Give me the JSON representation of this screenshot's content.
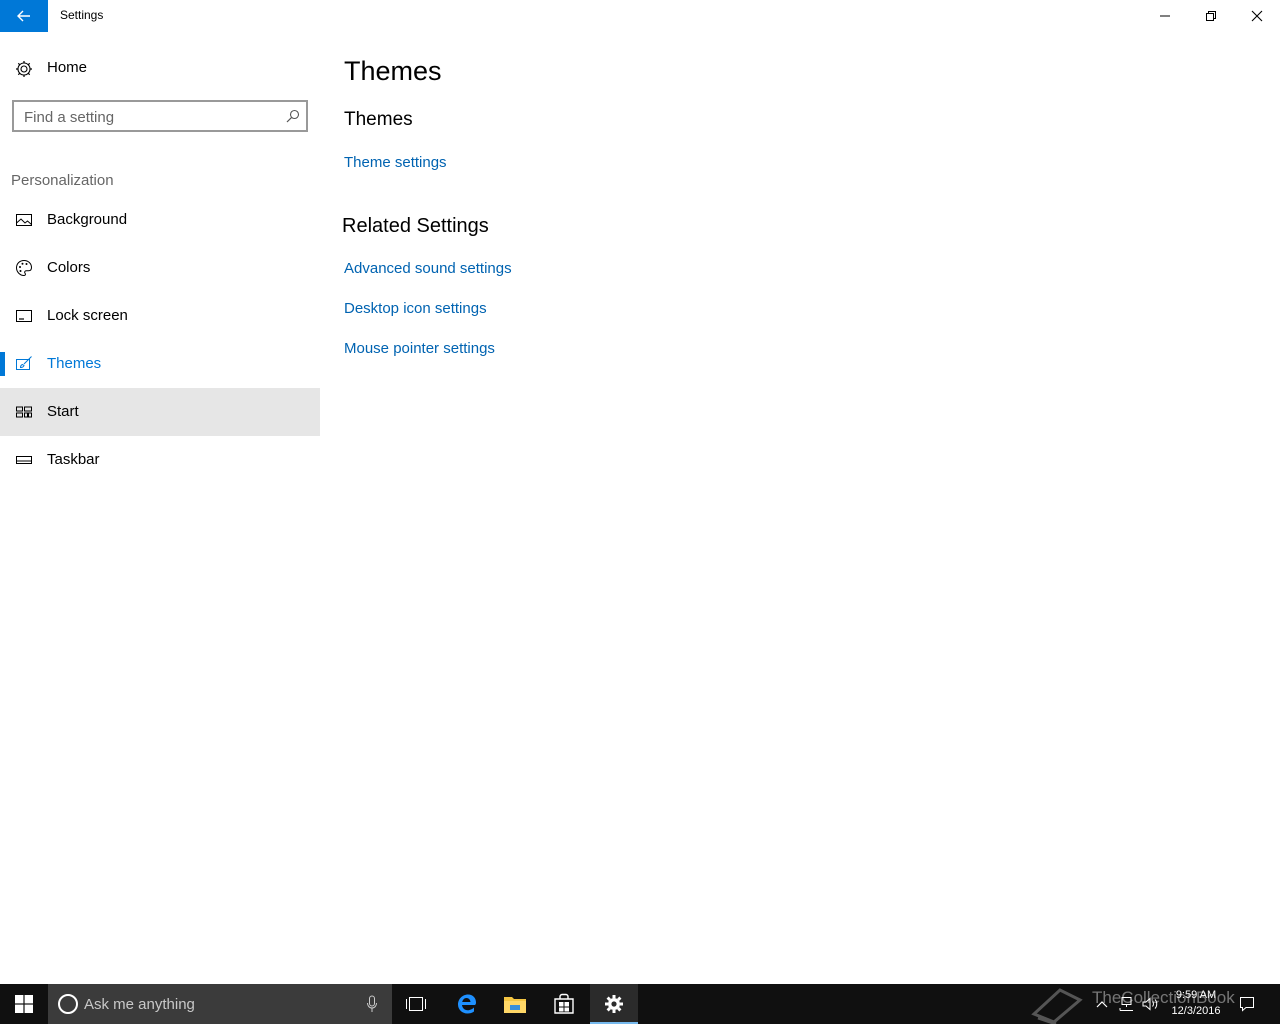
{
  "window": {
    "title": "Settings"
  },
  "sidebar": {
    "home_label": "Home",
    "search_placeholder": "Find a setting",
    "section_label": "Personalization",
    "items": [
      {
        "label": "Background",
        "icon": "picture-icon"
      },
      {
        "label": "Colors",
        "icon": "palette-icon"
      },
      {
        "label": "Lock screen",
        "icon": "lock-screen-icon"
      },
      {
        "label": "Themes",
        "icon": "brush-icon",
        "selected": true
      },
      {
        "label": "Start",
        "icon": "start-tiles-icon",
        "hovered": true
      },
      {
        "label": "Taskbar",
        "icon": "taskbar-icon"
      }
    ]
  },
  "main": {
    "page_title": "Themes",
    "themes_heading": "Themes",
    "theme_settings_link": "Theme settings",
    "related_heading": "Related Settings",
    "related_links": [
      "Advanced sound settings",
      "Desktop icon settings",
      "Mouse pointer settings"
    ]
  },
  "taskbar": {
    "search_placeholder": "Ask me anything",
    "time": "9:59 AM",
    "date": "12/3/2016",
    "watermark": "TheCollectionBook"
  },
  "colors": {
    "accent": "#0078d7",
    "link": "#0063b1",
    "taskbar": "#101010",
    "hover": "#e6e6e6"
  }
}
